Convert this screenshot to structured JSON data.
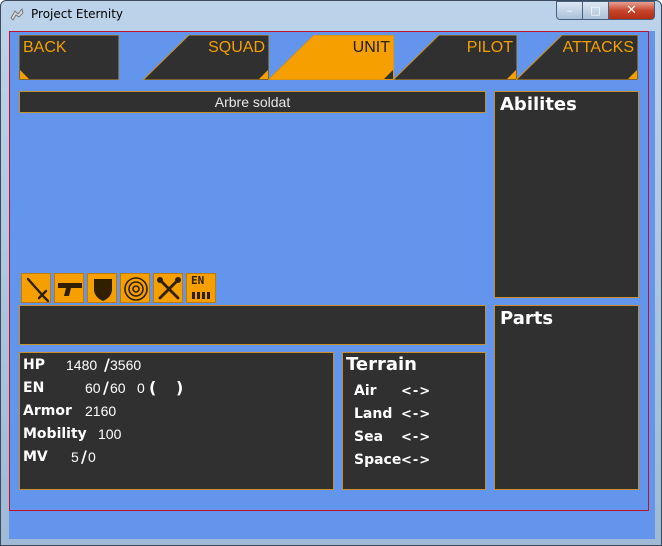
{
  "window": {
    "title": "Project Eternity",
    "controls": {
      "minimize": "–",
      "maximize": "□",
      "close": "✕"
    }
  },
  "tabs": [
    {
      "label": "BACK",
      "active": false
    },
    {
      "label": "SQUAD",
      "active": false
    },
    {
      "label": "UNIT",
      "active": true
    },
    {
      "label": "PILOT",
      "active": false
    },
    {
      "label": "ATTACKS",
      "active": false
    }
  ],
  "unit": {
    "name": "Arbre soldat"
  },
  "icons": [
    "sword-icon",
    "gun-icon",
    "shield-icon",
    "target-icon",
    "crossed-tools-icon",
    "energy-icon"
  ],
  "icon_labels": {
    "energy": "EN"
  },
  "stats": {
    "hp": {
      "label": "HP",
      "current": "1480",
      "max": "3560",
      "sep": "/"
    },
    "en": {
      "label": "EN",
      "current": "60",
      "max": "60",
      "sep": "/",
      "extra": "0",
      "paren_open": "(",
      "paren_close": ")"
    },
    "armor": {
      "label": "Armor",
      "value": "2160"
    },
    "mobility": {
      "label": "Mobility",
      "value": "100"
    },
    "mv": {
      "label": "MV",
      "current": "5",
      "max": "0",
      "sep": "/"
    }
  },
  "terrain": {
    "title": "Terrain",
    "rows": [
      {
        "label": "Air",
        "value": "<->"
      },
      {
        "label": "Land",
        "value": "<->"
      },
      {
        "label": "Sea",
        "value": "<->"
      },
      {
        "label": "Space",
        "value": "<->"
      }
    ]
  },
  "abilities": {
    "title": "Abilites"
  },
  "parts": {
    "title": "Parts"
  },
  "colors": {
    "accent": "#f5a000",
    "panel": "#303030",
    "background": "#6495ed",
    "border": "#c8902a"
  }
}
